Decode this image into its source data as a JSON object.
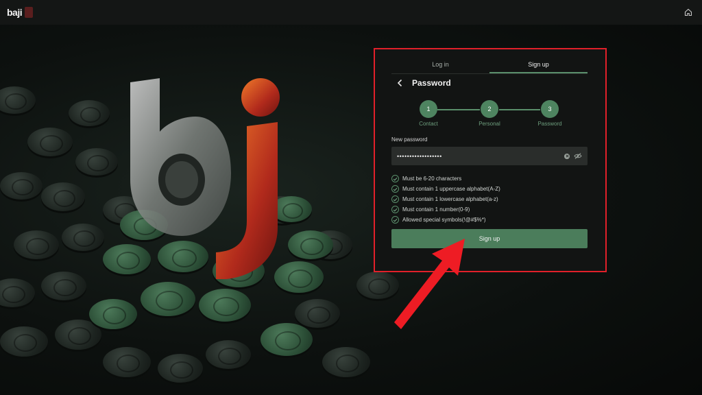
{
  "brand": {
    "logo_text": "baji"
  },
  "tabs": [
    {
      "label": "Log in",
      "active": false
    },
    {
      "label": "Sign up",
      "active": true
    }
  ],
  "form": {
    "title": "Password",
    "steps": [
      {
        "number": "1",
        "label": "Contact"
      },
      {
        "number": "2",
        "label": "Personal"
      },
      {
        "number": "3",
        "label": "Password"
      }
    ],
    "password_label": "New password",
    "password_value": "••••••••••••••••••",
    "rules": [
      "Must be 6-20 characters",
      "Must contain 1 uppercase alphabet(A-Z)",
      "Must contain 1 lowercase alphabet(a-z)",
      "Must contain 1 number(0-9)",
      "Allowed special symbols(!@#$%*)"
    ],
    "submit_label": "Sign up"
  },
  "colors": {
    "accent": "#4b7d5b",
    "highlight_frame": "#e2202a",
    "arrow": "#ee1c24"
  },
  "icons": [
    "home-icon",
    "back-chevron-icon",
    "clear-icon",
    "eye-off-icon",
    "check-circle-icon"
  ]
}
